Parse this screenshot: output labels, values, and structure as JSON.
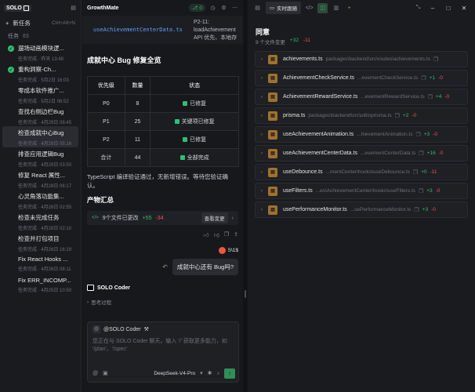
{
  "sidebar": {
    "logo_text": "SOLO",
    "new_task_label": "新任务",
    "new_task_shortcut": "Ctrl+Alt+N",
    "tasks_label": "任务",
    "tasks_count": "83",
    "tasks": [
      {
        "title": "遛场动画模块逻...",
        "meta": "任务完成 · 昨天 13:48",
        "status": "done"
      },
      {
        "title": "重构洞察-Ch...",
        "meta": "任务完成 · 5月2日 16:03",
        "status": "done"
      },
      {
        "title": "零成本软件推广...",
        "meta": "任务完成 · 5月2日 06:52",
        "status": "none"
      },
      {
        "title": "查找右侧边栏Bug",
        "meta": "任务完成 · 4月29日 08:45",
        "status": "none"
      },
      {
        "title": "检查成就中心Bug",
        "meta": "任务完成 · 4月29日 05:16",
        "status": "none"
      },
      {
        "title": "排查应用逻辑Bug",
        "meta": "任务完成 · 4月29日 03:50",
        "status": "none"
      },
      {
        "title": "修复 React 属性...",
        "meta": "任务完成 · 4月28日 06:17",
        "status": "none"
      },
      {
        "title": "心灵角落功能集...",
        "meta": "任务完成 · 4月28日 02:55",
        "status": "none"
      },
      {
        "title": "检查未完成任务",
        "meta": "任务完成 · 4月28日 02:10",
        "status": "none"
      },
      {
        "title": "检查并打包项目",
        "meta": "任务完成 · 4月26日 16:19",
        "status": "none"
      },
      {
        "title": "Fix React Hooks ...",
        "meta": "任务完成 · 4月26日 08:11",
        "status": "none"
      },
      {
        "title": "Fix ERR_INCOMP...",
        "meta": "任务完成 · 4月25日 10:50",
        "status": "none"
      }
    ]
  },
  "chat": {
    "brand": "GrowthMate",
    "status_pill": "0",
    "file_strip": {
      "file_name": "useAchievementCenterData.ts",
      "meta_line1": "P2-11:",
      "meta_line2": "loadAchievement",
      "meta_line3": "API 优先、本地存"
    },
    "section_title": "成就中心 Bug 修复全览",
    "table": {
      "headers": [
        "优先级",
        "数量",
        "状态"
      ],
      "rows": [
        {
          "priority": "P0",
          "count": "8",
          "status": "已修复"
        },
        {
          "priority": "P1",
          "count": "25",
          "status": "关键项已修复"
        },
        {
          "priority": "P2",
          "count": "11",
          "status": "已修复"
        },
        {
          "priority": "合计",
          "count": "44",
          "status": "全部完成"
        }
      ]
    },
    "note": "TypeScript 编译验证通过，无新增错误。等待您验证确认。",
    "summary_title": "产物汇总",
    "summary": {
      "text": "9个文件已更改",
      "additions": "+55",
      "deletions": "-34",
      "view_label": "查看变更"
    },
    "user_name": "S\\1$",
    "user_message": "成就中心还有 Bug吗?",
    "assistant_name": "SOLO Coder",
    "thinking_label": "思考过程",
    "composer": {
      "agent_tag": "@SOLO Coder",
      "placeholder": "您正在与 SOLO Coder 聊天。输入 '/' 获取更多能力，如 '/plan'、'/spec'",
      "model": "DeepSeek-V4-Pro"
    }
  },
  "right": {
    "tab_label": "实时跟随",
    "title": "同意",
    "stats": {
      "changed": "9 个文件变更",
      "additions": "+32",
      "deletions": "-11"
    },
    "files": [
      {
        "name": "achievements.ts",
        "path": "packages\\backend\\src\\routes\\achievements.ts",
        "add": "",
        "del": ""
      },
      {
        "name": "AchievementCheckService.ts",
        "path": "...evementCheckService.ts",
        "add": "+1",
        "del": "-0"
      },
      {
        "name": "AchievementRewardService.ts",
        "path": "...evementRewardService.ts",
        "add": "+4",
        "del": "-0"
      },
      {
        "name": "prisma.ts",
        "path": "packages\\backend\\src\\utils\\prisma.ts",
        "add": "+2",
        "del": "-0"
      },
      {
        "name": "useAchievementAnimation.ts",
        "path": "...hievementAnimation.ts",
        "add": "+3",
        "del": "-0"
      },
      {
        "name": "useAchievementCenterData.ts",
        "path": "...evementCenterData.ts",
        "add": "+16",
        "del": "-0"
      },
      {
        "name": "useDebounce.ts",
        "path": "...mentCenter\\hooks\\useDebounce.ts",
        "add": "+0",
        "del": "-11"
      },
      {
        "name": "useFilters.ts",
        "path": "...es\\AchievementCenter\\hooks\\useFilters.ts",
        "add": "+3",
        "del": "-0"
      },
      {
        "name": "usePerformanceMonitor.ts",
        "path": "...sePerformanceMonitor.ts",
        "add": "+3",
        "del": "-0"
      }
    ]
  }
}
